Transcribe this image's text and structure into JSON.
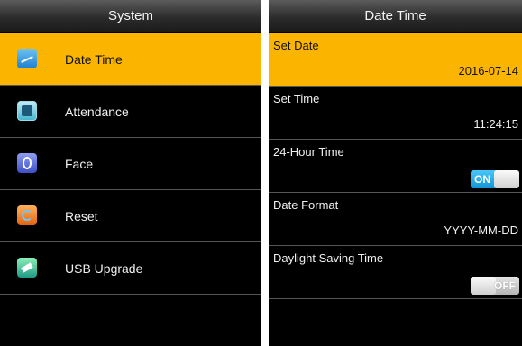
{
  "left_panel": {
    "title": "System",
    "items": [
      {
        "label": "Date Time",
        "icon": "clock-icon"
      },
      {
        "label": "Attendance",
        "icon": "attendance-icon"
      },
      {
        "label": "Face",
        "icon": "face-icon"
      },
      {
        "label": "Reset",
        "icon": "reset-icon"
      },
      {
        "label": "USB Upgrade",
        "icon": "usb-upgrade-icon"
      }
    ]
  },
  "right_panel": {
    "title": "Date Time",
    "rows": [
      {
        "label": "Set Date",
        "value": "2016-07-14"
      },
      {
        "label": "Set Time",
        "value": "11:24:15"
      },
      {
        "label": "24-Hour Time",
        "toggle": "ON"
      },
      {
        "label": "Date Format",
        "value": "YYYY-MM-DD"
      },
      {
        "label": "Daylight Saving Time",
        "toggle": "OFF"
      }
    ]
  },
  "colors": {
    "highlight": "#fbb500",
    "background": "#000000",
    "toggle_on": "#1e9fe3"
  }
}
